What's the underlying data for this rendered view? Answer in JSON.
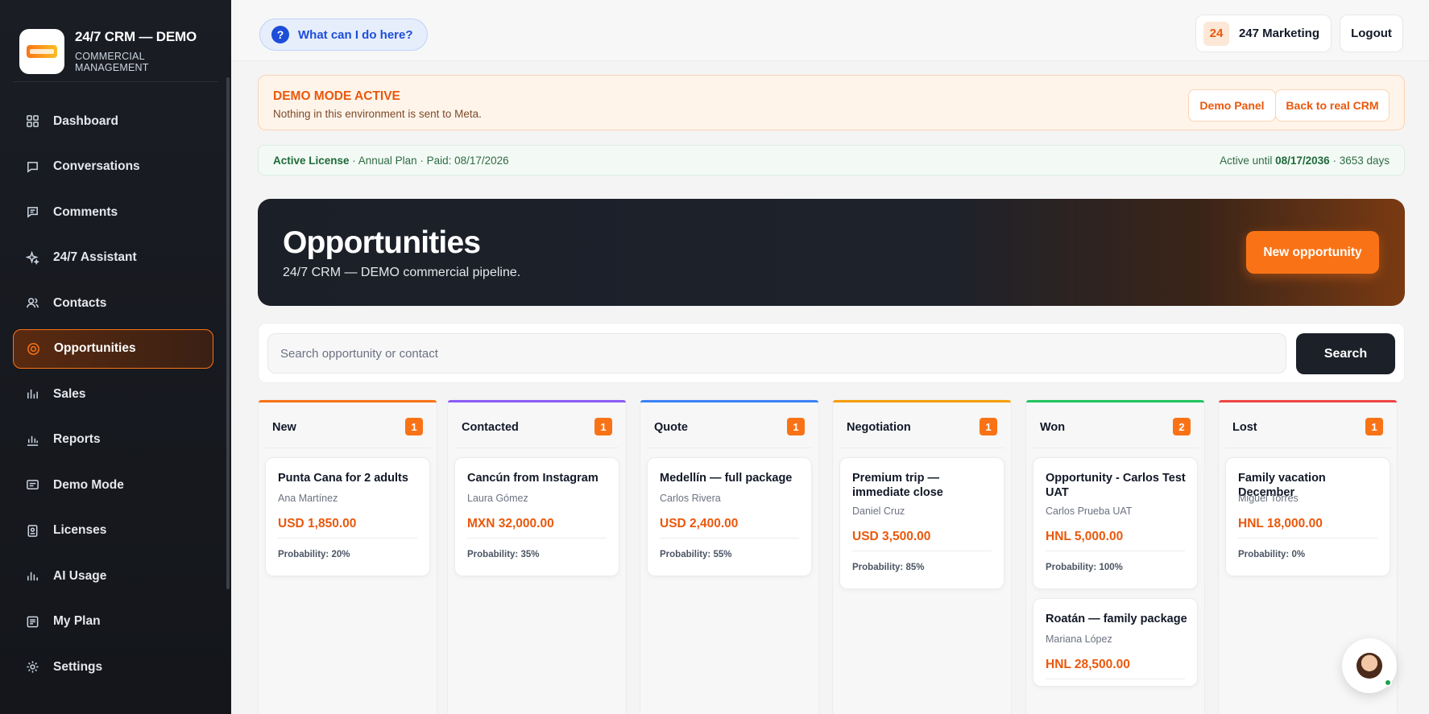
{
  "brand": {
    "title": "24/7 CRM — DEMO",
    "subtitle": "COMMERCIAL MANAGEMENT"
  },
  "sidebar": {
    "items": [
      {
        "label": "Dashboard",
        "icon": "grid-icon"
      },
      {
        "label": "Conversations",
        "icon": "chat-icon"
      },
      {
        "label": "Comments",
        "icon": "comment-icon"
      },
      {
        "label": "24/7 Assistant",
        "icon": "sparkle-icon"
      },
      {
        "label": "Contacts",
        "icon": "users-icon"
      },
      {
        "label": "Opportunities",
        "icon": "target-icon",
        "active": true
      },
      {
        "label": "Sales",
        "icon": "bar-chart-icon"
      },
      {
        "label": "Reports",
        "icon": "report-chart-icon"
      },
      {
        "label": "Demo Mode",
        "icon": "monitor-icon"
      },
      {
        "label": "Licenses",
        "icon": "license-icon"
      },
      {
        "label": "AI Usage",
        "icon": "usage-chart-icon"
      },
      {
        "label": "My Plan",
        "icon": "plan-icon"
      },
      {
        "label": "Settings",
        "icon": "gear-icon"
      }
    ]
  },
  "topbar": {
    "help_label": "What can I do here?",
    "account_badge": "24",
    "account_name": "247 Marketing",
    "logout_label": "Logout"
  },
  "demo_banner": {
    "title": "DEMO MODE ACTIVE",
    "subtitle": "Nothing in this environment is sent to Meta.",
    "panel_label": "Demo Panel",
    "back_label": "Back to real CRM"
  },
  "license": {
    "status": "Active License",
    "details": " · Annual Plan · Paid: 08/17/2026",
    "until_prefix": "Active until ",
    "until_date": "08/17/2036",
    "days": " · 3653 days"
  },
  "hero": {
    "title": "Opportunities",
    "subtitle": "24/7 CRM — DEMO commercial pipeline.",
    "new_label": "New opportunity"
  },
  "search": {
    "placeholder": "Search opportunity or contact",
    "button_label": "Search"
  },
  "colors": {
    "accent": "#f97316",
    "new": "#f97316",
    "contacted": "#8b5cf6",
    "quote": "#3b82f6",
    "negotiation": "#f59e0b",
    "won": "#22c55e",
    "lost": "#ef4444"
  },
  "columns": [
    {
      "name": "New",
      "count": "1",
      "cards": [
        {
          "title": "Punta Cana for 2 adults",
          "contact": "Ana Martínez",
          "amount": "USD 1,850.00",
          "probability": "Probability: 20%"
        }
      ]
    },
    {
      "name": "Contacted",
      "count": "1",
      "cards": [
        {
          "title": "Cancún from Instagram",
          "contact": "Laura Gómez",
          "amount": "MXN 32,000.00",
          "probability": "Probability: 35%"
        }
      ]
    },
    {
      "name": "Quote",
      "count": "1",
      "cards": [
        {
          "title": "Medellín — full package",
          "contact": "Carlos Rivera",
          "amount": "USD 2,400.00",
          "probability": "Probability: 55%"
        }
      ]
    },
    {
      "name": "Negotiation",
      "count": "1",
      "cards": [
        {
          "title": "Premium trip — immediate close",
          "contact": "Daniel Cruz",
          "amount": "USD 3,500.00",
          "probability": "Probability: 85%"
        }
      ]
    },
    {
      "name": "Won",
      "count": "2",
      "cards": [
        {
          "title": "Opportunity - Carlos Test UAT",
          "contact": "Carlos Prueba UAT",
          "amount": "HNL 5,000.00",
          "probability": "Probability: 100%"
        },
        {
          "title": "Roatán — family package",
          "contact": "Mariana López",
          "amount": "HNL 28,500.00",
          "probability": ""
        }
      ]
    },
    {
      "name": "Lost",
      "count": "1",
      "cards": [
        {
          "title": "Family vacation December",
          "contact": "Miguel Torres",
          "amount": "HNL 18,000.00",
          "probability": "Probability: 0%"
        }
      ]
    }
  ]
}
